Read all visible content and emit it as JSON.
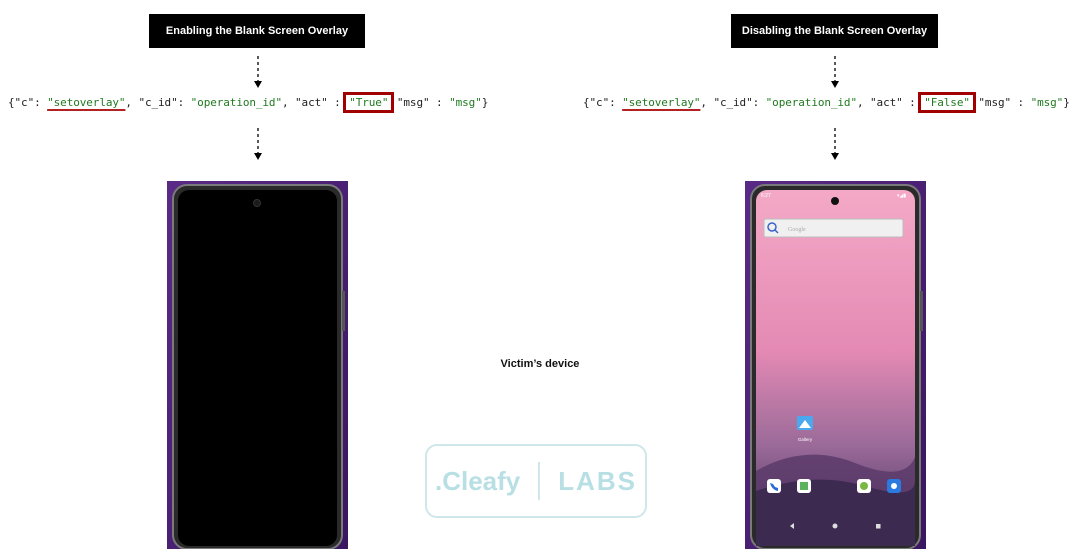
{
  "left": {
    "title": "Enabling the Blank Screen Overlay",
    "code": {
      "p1": "{\"c\": ",
      "c_val": "\"setoverlay\"",
      "p2": ", \"c_id\": ",
      "cid_val": "\"operation_id\"",
      "p3": ", \"act\" : ",
      "act_val": "\"True\"",
      "p4": "  \"msg\" : ",
      "msg_val": "\"msg\"",
      "p5": "}"
    }
  },
  "right": {
    "title": "Disabling the Blank Screen Overlay",
    "code": {
      "p1": "{\"c\": ",
      "c_val": "\"setoverlay\"",
      "p2": ", \"c_id\": ",
      "cid_val": "\"operation_id\"",
      "p3": ", \"act\" : ",
      "act_val": "\"False\"",
      "p4": "  \"msg\" : ",
      "msg_val": "\"msg\"",
      "p5": "}"
    },
    "phone": {
      "status_time": "6:27",
      "search_placeholder": "Google",
      "gallery_label": "Gallery"
    }
  },
  "center_label": "Victim’s device",
  "logo": {
    "left_text": ".Cleafy",
    "right_text": "LABS"
  },
  "colors": {
    "string": "#1f7a1f",
    "highlight_box": "#a00000",
    "underline": "#b22222",
    "logo": "#b8dfe4"
  }
}
